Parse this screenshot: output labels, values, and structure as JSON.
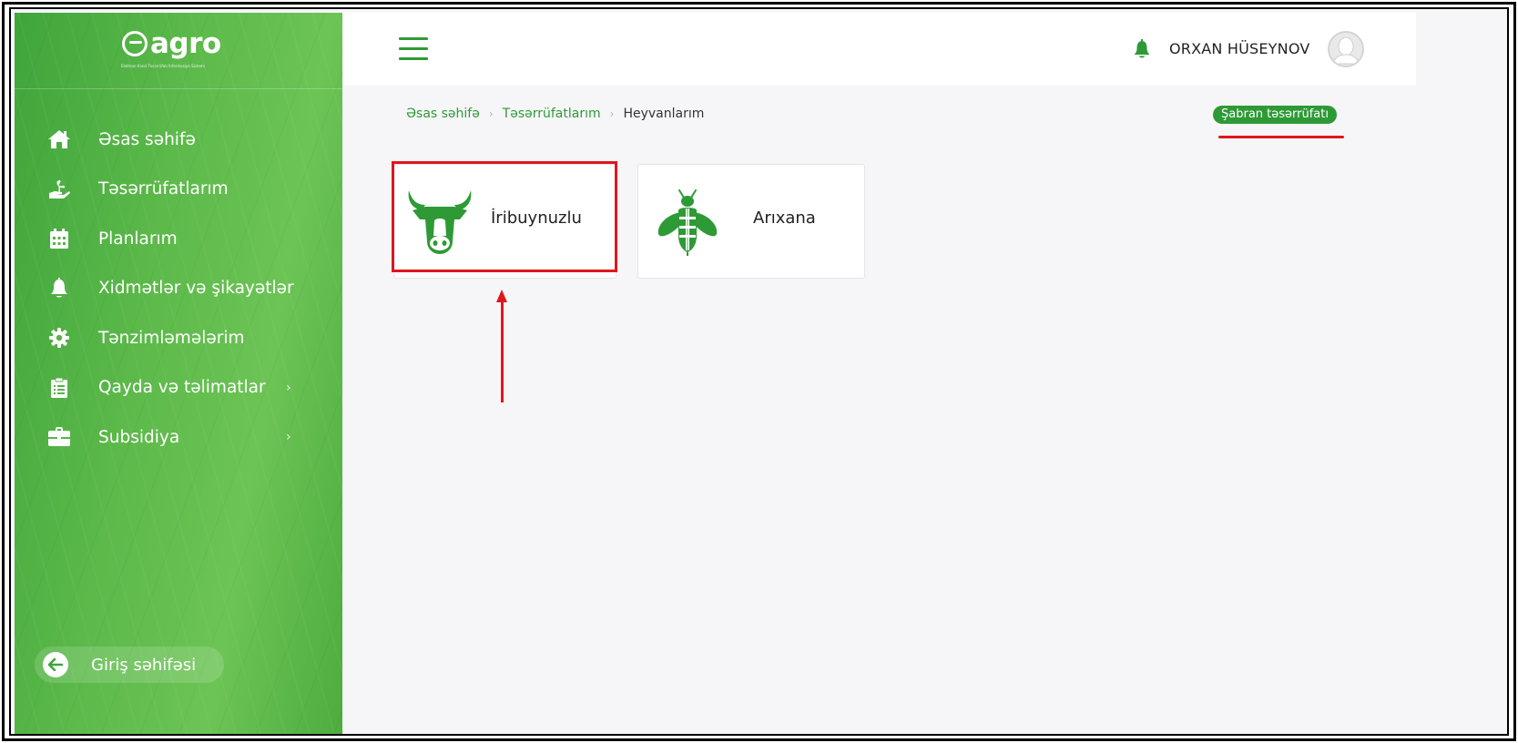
{
  "app": {
    "logo_text": "agro",
    "logo_subtitle": "Elektron Kənd Təsərrüfatı İnformasiya Sistemi"
  },
  "sidebar": {
    "items": [
      {
        "label": "Əsas səhifə",
        "icon": "home-icon"
      },
      {
        "label": "Təsərrüfatlarım",
        "icon": "hand-plant-icon"
      },
      {
        "label": "Planlarım",
        "icon": "calendar-icon"
      },
      {
        "label": "Xidmətlər və şikayətlər",
        "icon": "bell-icon"
      },
      {
        "label": "Tənzimləmələrim",
        "icon": "gear-icon"
      },
      {
        "label": "Qayda və təlimatlar",
        "icon": "clipboard-icon",
        "chevron": "›"
      },
      {
        "label": "Subsidiya",
        "icon": "briefcase-icon",
        "chevron": "›"
      }
    ],
    "back_button": {
      "label": "Giriş səhifəsi",
      "icon": "arrow-left-icon"
    }
  },
  "header": {
    "menu_icon": "hamburger-icon",
    "notification_icon": "bell-icon",
    "user_name": "ORXAN HÜSEYNOV",
    "avatar_icon": "user-avatar-icon"
  },
  "breadcrumb": {
    "items": [
      "Əsas səhifə",
      "Təsərrüfatlarım"
    ],
    "separator": "›",
    "current": "Heyvanlarım"
  },
  "farm_badge": "Şabran təsərrüfatı",
  "categories": [
    {
      "label": "İribuynuzlu",
      "icon": "cow-icon"
    },
    {
      "label": "Arıxana",
      "icon": "bee-icon"
    }
  ],
  "colors": {
    "brand_green": "#2e9a36",
    "annotation_red": "#e0161d",
    "sidebar_green": "#5cb94a"
  }
}
